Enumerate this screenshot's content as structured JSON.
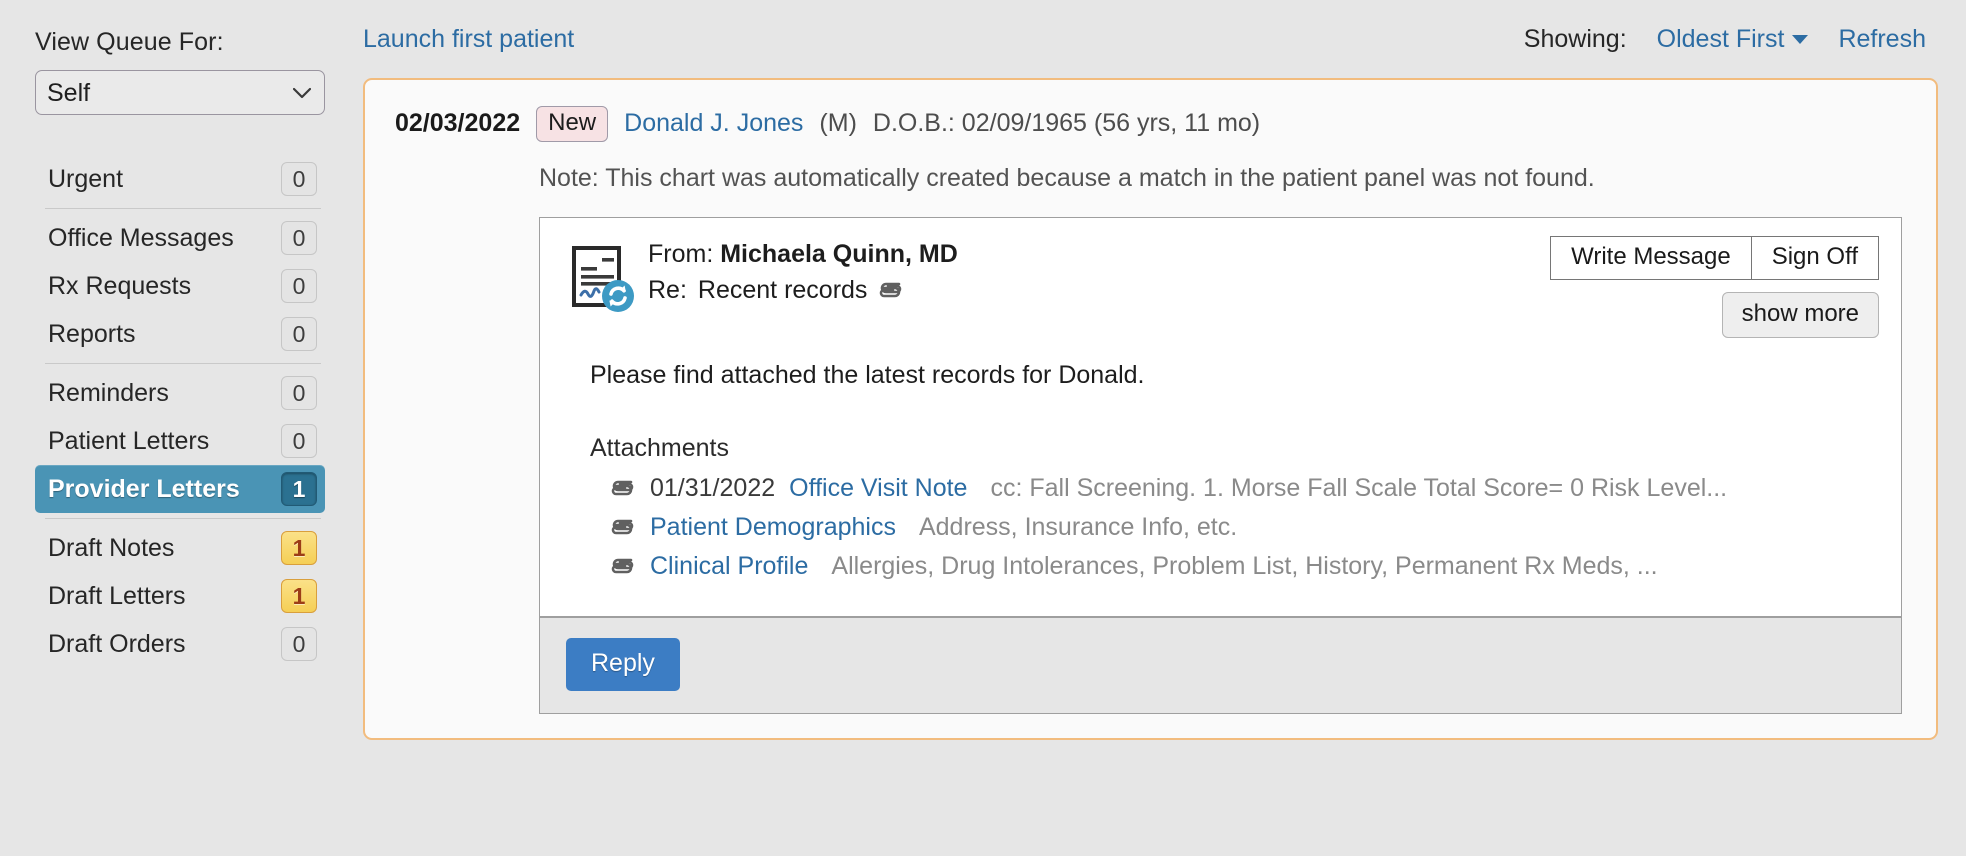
{
  "sidebar": {
    "queue_label": "View Queue For:",
    "queue_selected": "Self",
    "queue_options": [
      "Self"
    ],
    "items": [
      {
        "label": "Urgent",
        "count": "0",
        "active": false,
        "badge_style": "zero",
        "sep_after": true
      },
      {
        "label": "Office Messages",
        "count": "0",
        "active": false,
        "badge_style": "zero",
        "sep_after": false
      },
      {
        "label": "Rx Requests",
        "count": "0",
        "active": false,
        "badge_style": "zero",
        "sep_after": false
      },
      {
        "label": "Reports",
        "count": "0",
        "active": false,
        "badge_style": "zero",
        "sep_after": true
      },
      {
        "label": "Reminders",
        "count": "0",
        "active": false,
        "badge_style": "zero",
        "sep_after": false
      },
      {
        "label": "Patient Letters",
        "count": "0",
        "active": false,
        "badge_style": "zero",
        "sep_after": false
      },
      {
        "label": "Provider Letters",
        "count": "1",
        "active": true,
        "badge_style": "on-active",
        "sep_after": true
      },
      {
        "label": "Draft Notes",
        "count": "1",
        "active": false,
        "badge_style": "warn",
        "sep_after": false
      },
      {
        "label": "Draft Letters",
        "count": "1",
        "active": false,
        "badge_style": "warn",
        "sep_after": false
      },
      {
        "label": "Draft Orders",
        "count": "0",
        "active": false,
        "badge_style": "zero",
        "sep_after": false
      }
    ]
  },
  "topbar": {
    "launch_link": "Launch first patient",
    "showing_label": "Showing:",
    "sort_value": "Oldest First",
    "sort_caret_icon": "chevron-down-icon",
    "refresh_label": "Refresh"
  },
  "queue_item": {
    "date": "02/03/2022",
    "status_pill": "New",
    "patient_name": "Donald J. Jones",
    "patient_sex": "(M)",
    "patient_dob": "D.O.B.: 02/09/1965 (56 yrs, 11 mo)",
    "note": "Note: This chart was automatically created because a match in the patient panel was not found."
  },
  "message": {
    "doc_icon": "document-sync-icon",
    "from_prefix": "From:",
    "from_name": "Michaela Quinn, MD",
    "re_prefix": "Re:",
    "re_subject": "Recent records",
    "re_attach_icon": "paperclip-icon",
    "body_text": "Please find attached the latest records for Donald.",
    "write_message_label": "Write Message",
    "sign_off_label": "Sign Off",
    "show_more_label": "show more",
    "attachments_title": "Attachments",
    "attachments": [
      {
        "icon": "paperclip-icon",
        "date": "01/31/2022",
        "link": "Office Visit Note",
        "desc": "cc: Fall Screening. 1. Morse Fall Scale Total Score= 0 Risk Level..."
      },
      {
        "icon": "paperclip-icon",
        "date": "",
        "link": "Patient Demographics",
        "desc": "Address, Insurance Info, etc."
      },
      {
        "icon": "paperclip-icon",
        "date": "",
        "link": "Clinical Profile",
        "desc": "Allergies, Drug Intolerances, Problem List, History, Permanent Rx Meds, ..."
      }
    ],
    "reply_label": "Reply"
  },
  "colors": {
    "page_bg": "#e6e6e6",
    "accent_link": "#2c6ca3",
    "active_nav": "#4a94b5",
    "card_border": "#f2bc7e",
    "reply_blue": "#3c7dc4",
    "warn_badge": "#f5cf56"
  }
}
